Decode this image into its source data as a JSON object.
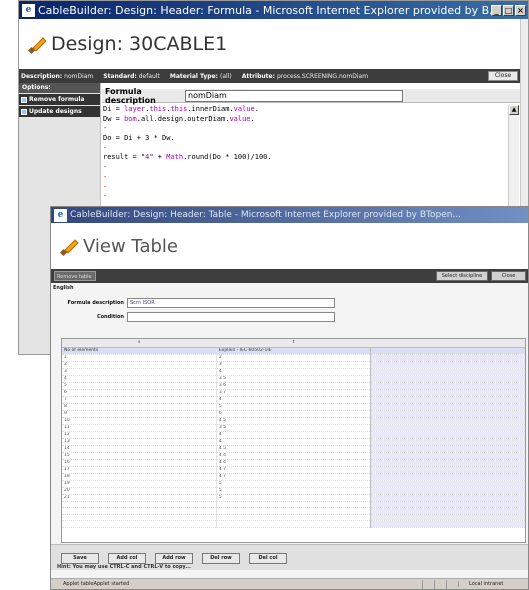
{
  "window1": {
    "title_bar": "CableBuilder: Design: Header: Formula - Microsoft Internet Explorer provided by B...",
    "heading": "Design: 30CABLE1",
    "info": {
      "description_label": "Description:",
      "description_value": "nomDiam",
      "standard_label": "Standard:",
      "standard_value": "default",
      "material_type_label": "Material Type:",
      "material_type_value": "(all)",
      "attribute_label": "Attribute:",
      "attribute_value": "process.SCREENING.nomDiam",
      "close_label": "Close"
    },
    "sidebar": {
      "header": "Options:",
      "items": [
        {
          "label": "Remove formula"
        },
        {
          "label": "Update designs"
        }
      ]
    },
    "formula_description_label": "Formula description",
    "formula_description_value": "nomDiam"
  },
  "window2": {
    "title_bar": "CableBuilder: Design: Header: Table - Microsoft Internet Explorer provided by BTopen...",
    "heading": "View Table",
    "toolbar": {
      "remove_label": "Remove table",
      "select_label": "Select discipline",
      "close_label": "Close"
    },
    "language": "English",
    "fields": [
      {
        "label": "Formula description",
        "value": "Scrn ISOR"
      },
      {
        "label": "Condition",
        "value": ""
      }
    ],
    "table": {
      "headers": [
        "s",
        "t"
      ],
      "rows": [
        [
          "No of elements",
          "Explain - IEC 60502-1IE"
        ],
        [
          "1",
          "2"
        ],
        [
          "2",
          "3"
        ],
        [
          "3",
          "4"
        ],
        [
          "4",
          "3 5"
        ],
        [
          "5",
          "3 6"
        ],
        [
          "6",
          "3 7"
        ],
        [
          "7",
          "4"
        ],
        [
          "8",
          "5"
        ],
        [
          "9",
          "6"
        ],
        [
          "10",
          "4 5"
        ],
        [
          "11",
          "3 5"
        ],
        [
          "12",
          "4"
        ],
        [
          "13",
          "4"
        ],
        [
          "14",
          "4 5"
        ],
        [
          "15",
          "4 4"
        ],
        [
          "16",
          "4 4"
        ],
        [
          "17",
          "4 7"
        ],
        [
          "18",
          "4 7"
        ],
        [
          "19",
          "5"
        ],
        [
          "20",
          "5"
        ],
        [
          "21",
          "5"
        ],
        [
          "",
          ""
        ],
        [
          "",
          ""
        ],
        [
          "",
          ""
        ],
        [
          "",
          ""
        ]
      ]
    },
    "buttons": [
      "Save",
      "Add col",
      "Add row",
      "Del row",
      "Del col"
    ],
    "hint": "Hint: You may use CTRL-C and CTRL-V to copy...",
    "status_left": "Applet tableApplet started",
    "status_right": "Local intranet"
  }
}
